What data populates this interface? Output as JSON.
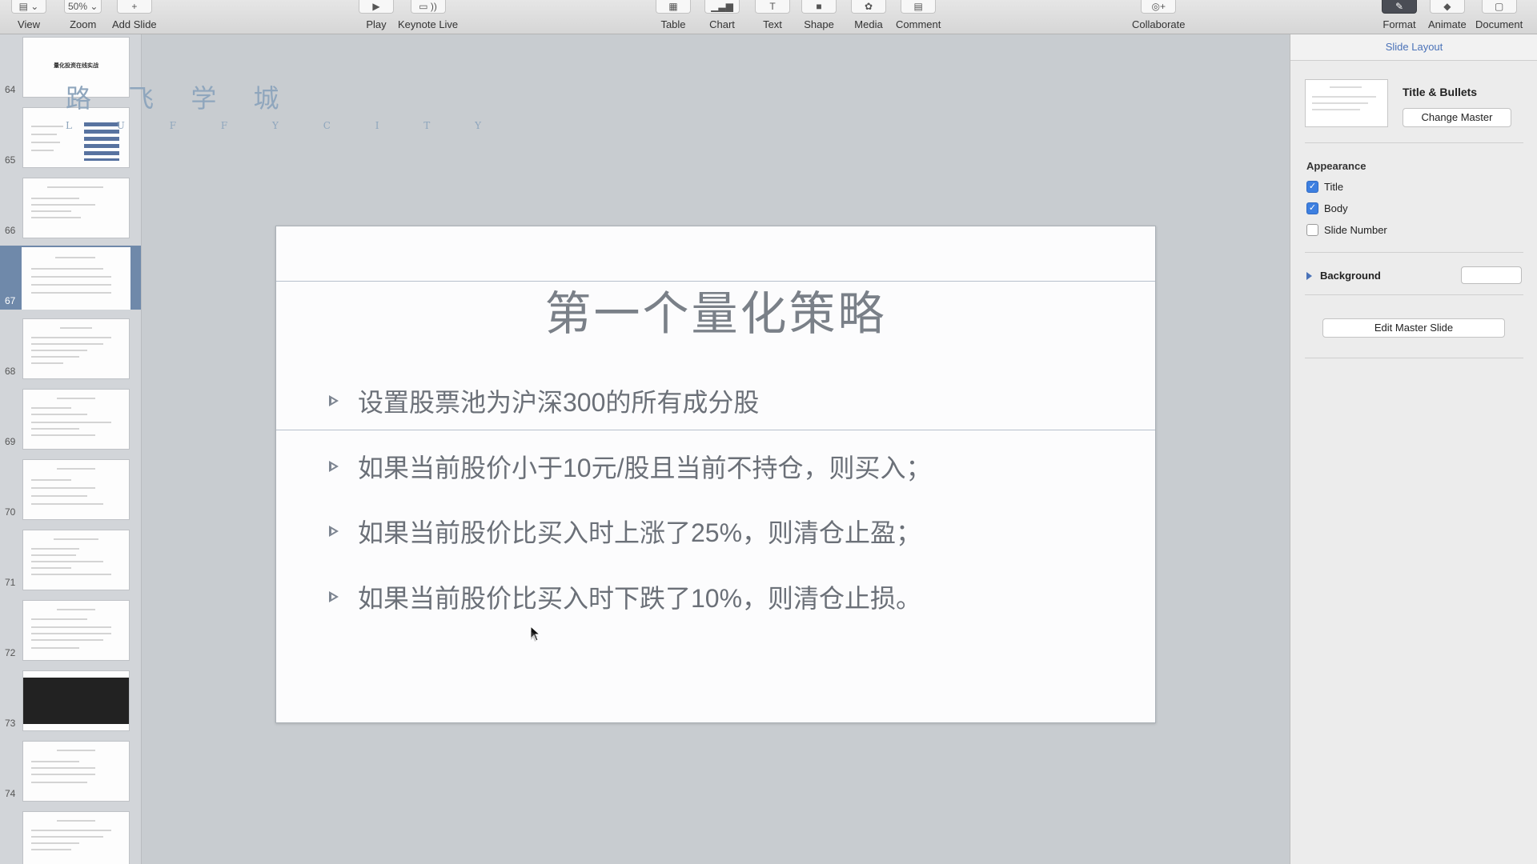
{
  "toolbar": {
    "view": "View",
    "zoom_value": "50%",
    "zoom": "Zoom",
    "add_slide": "Add Slide",
    "play": "Play",
    "keynote_live": "Keynote Live",
    "table": "Table",
    "chart": "Chart",
    "text": "Text",
    "shape": "Shape",
    "media": "Media",
    "comment": "Comment",
    "collaborate": "Collaborate",
    "format": "Format",
    "animate": "Animate",
    "document": "Document"
  },
  "navigator": {
    "selected_number": "67",
    "slides": [
      {
        "number": "64",
        "title": "量化投资在线实战"
      },
      {
        "number": "65",
        "title": ""
      },
      {
        "number": "66",
        "title": ""
      },
      {
        "number": "67",
        "title": ""
      },
      {
        "number": "68",
        "title": ""
      },
      {
        "number": "69",
        "title": ""
      },
      {
        "number": "70",
        "title": ""
      },
      {
        "number": "71",
        "title": ""
      },
      {
        "number": "72",
        "title": ""
      },
      {
        "number": "73",
        "title": ""
      },
      {
        "number": "74",
        "title": ""
      }
    ],
    "logo_cn": "路 飞 学 城",
    "logo_en": "L U F F Y C I T Y"
  },
  "slide": {
    "title": "第一个量化策略",
    "bullets": [
      "设置股票池为沪深300的所有成分股",
      "如果当前股价小于10元/股且当前不持仓，则买入；",
      "如果当前股价比买入时上涨了25%，则清仓止盈；",
      "如果当前股价比买入时下跌了10%，则清仓止损。"
    ]
  },
  "inspector": {
    "header": "Slide Layout",
    "layout_name": "Title & Bullets",
    "change_master": "Change Master",
    "appearance": "Appearance",
    "title_label": "Title",
    "title_checked": true,
    "body_label": "Body",
    "body_checked": true,
    "slide_number_label": "Slide Number",
    "slide_number_checked": false,
    "background_label": "Background",
    "edit_master": "Edit Master Slide"
  },
  "colors": {
    "selection": "#6f89aa",
    "accent": "#3d7fe0"
  }
}
